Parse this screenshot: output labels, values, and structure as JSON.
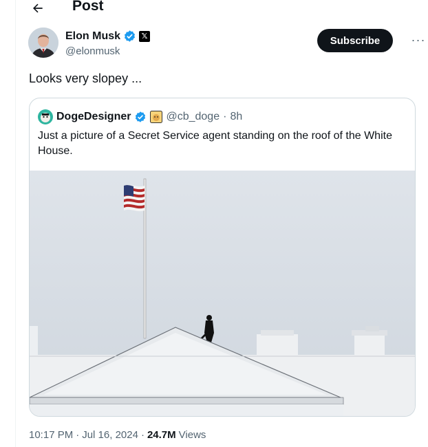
{
  "header": {
    "title": "Post",
    "back_icon": "arrow-left-icon"
  },
  "post": {
    "author_name": "Elon Musk",
    "author_handle": "@elonmusk",
    "verified_icon": "verified-badge-icon",
    "affiliate_icon": "x-logo-icon",
    "subscribe_label": "Subscribe",
    "more_label": "···",
    "text": "Looks very slopey ...",
    "time": "10:17 PM",
    "separator": "·",
    "date": "Jul 16, 2024",
    "views_count": "24.7M",
    "views_label": "Views"
  },
  "quote": {
    "name": "DogeDesigner",
    "handle": "@cb_doge",
    "separator": "·",
    "age": "8h",
    "text": "Just a picture of a Secret Service agent standing on the roof of the White House."
  },
  "colors": {
    "brand": "#1d9bf0",
    "text": "#0f1419",
    "muted": "#536471",
    "border": "#cfd9de"
  }
}
